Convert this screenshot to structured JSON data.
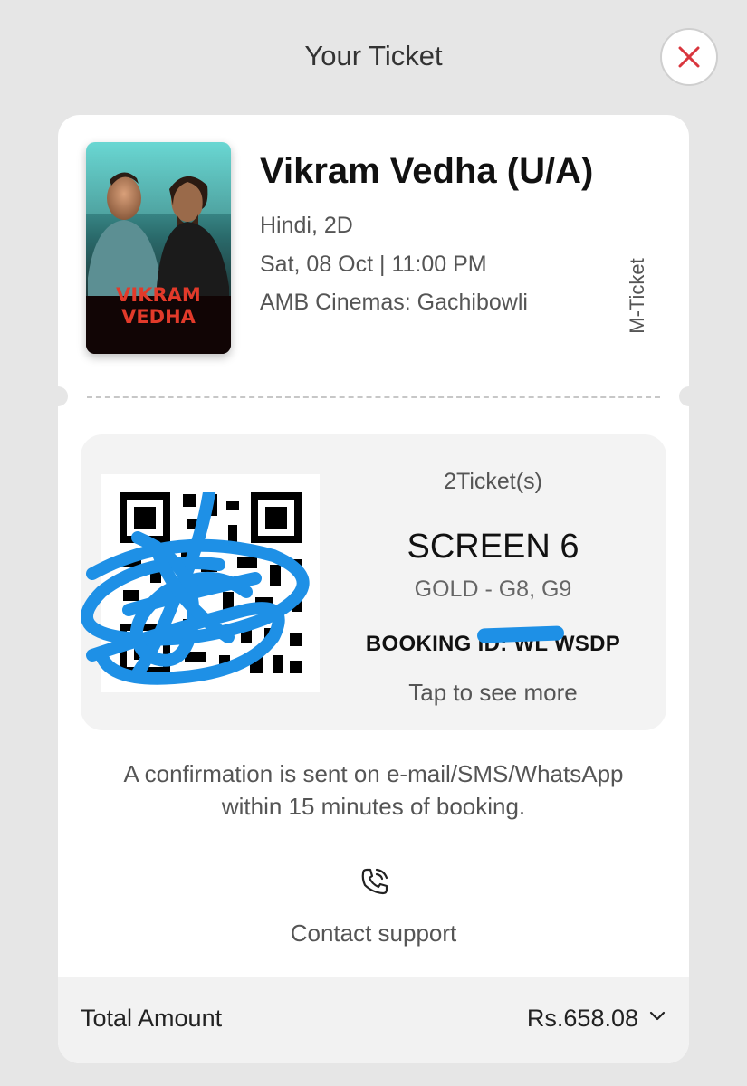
{
  "header": {
    "title": "Your Ticket"
  },
  "movie": {
    "title": "Vikram Vedha (U/A)",
    "language_format": "Hindi, 2D",
    "datetime": "Sat, 08 Oct | 11:00 PM",
    "venue": "AMB Cinemas: Gachibowli",
    "ticket_type": "M-Ticket",
    "poster_title_line1": "VIKRAM",
    "poster_title_line2": "VEDHA"
  },
  "booking": {
    "ticket_count": "2Ticket(s)",
    "screen": "SCREEN 6",
    "seats": "GOLD - G8, G9",
    "booking_id": "BOOKING ID: WL    WSDP",
    "tap_hint": "Tap to see more"
  },
  "confirmation": {
    "line1": "A confirmation is sent on e-mail/SMS/WhatsApp",
    "line2": "within 15 minutes of booking."
  },
  "support": {
    "label": "Contact support",
    "icon": "phone-call-icon"
  },
  "total": {
    "label": "Total Amount",
    "amount": "Rs.658.08"
  },
  "colors": {
    "close_accent": "#d9363e",
    "scribble": "#1e90e6",
    "background": "#e6e6e6"
  }
}
